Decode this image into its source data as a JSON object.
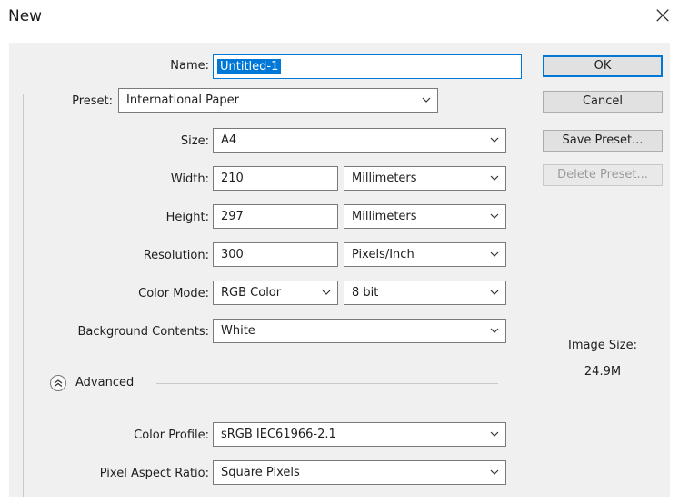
{
  "window": {
    "title": "New"
  },
  "form": {
    "name_label": "Name:",
    "name_value": "Untitled-1",
    "preset_label": "Preset:",
    "preset_value": "International Paper",
    "size_label": "Size:",
    "size_value": "A4",
    "width_label": "Width:",
    "width_value": "210",
    "width_unit": "Millimeters",
    "height_label": "Height:",
    "height_value": "297",
    "height_unit": "Millimeters",
    "resolution_label": "Resolution:",
    "resolution_value": "300",
    "resolution_unit": "Pixels/Inch",
    "color_mode_label": "Color Mode:",
    "color_mode_value": "RGB Color",
    "bit_depth_value": "8 bit",
    "background_label": "Background Contents:",
    "background_value": "White",
    "advanced_label": "Advanced",
    "color_profile_label": "Color Profile:",
    "color_profile_value": "sRGB IEC61966-2.1",
    "pixel_aspect_label": "Pixel Aspect Ratio:",
    "pixel_aspect_value": "Square Pixels"
  },
  "buttons": {
    "ok": "OK",
    "cancel": "Cancel",
    "save_preset": "Save Preset...",
    "delete_preset": "Delete Preset..."
  },
  "image_size": {
    "label": "Image Size:",
    "value": "24.9M"
  },
  "colors": {
    "accent": "#0078d7",
    "panel": "#f0f0f0",
    "border": "#7a7a7a"
  },
  "icons": {
    "close": "close-icon",
    "chevron": "chevron-down-icon",
    "advanced": "collapse-advanced-icon"
  }
}
